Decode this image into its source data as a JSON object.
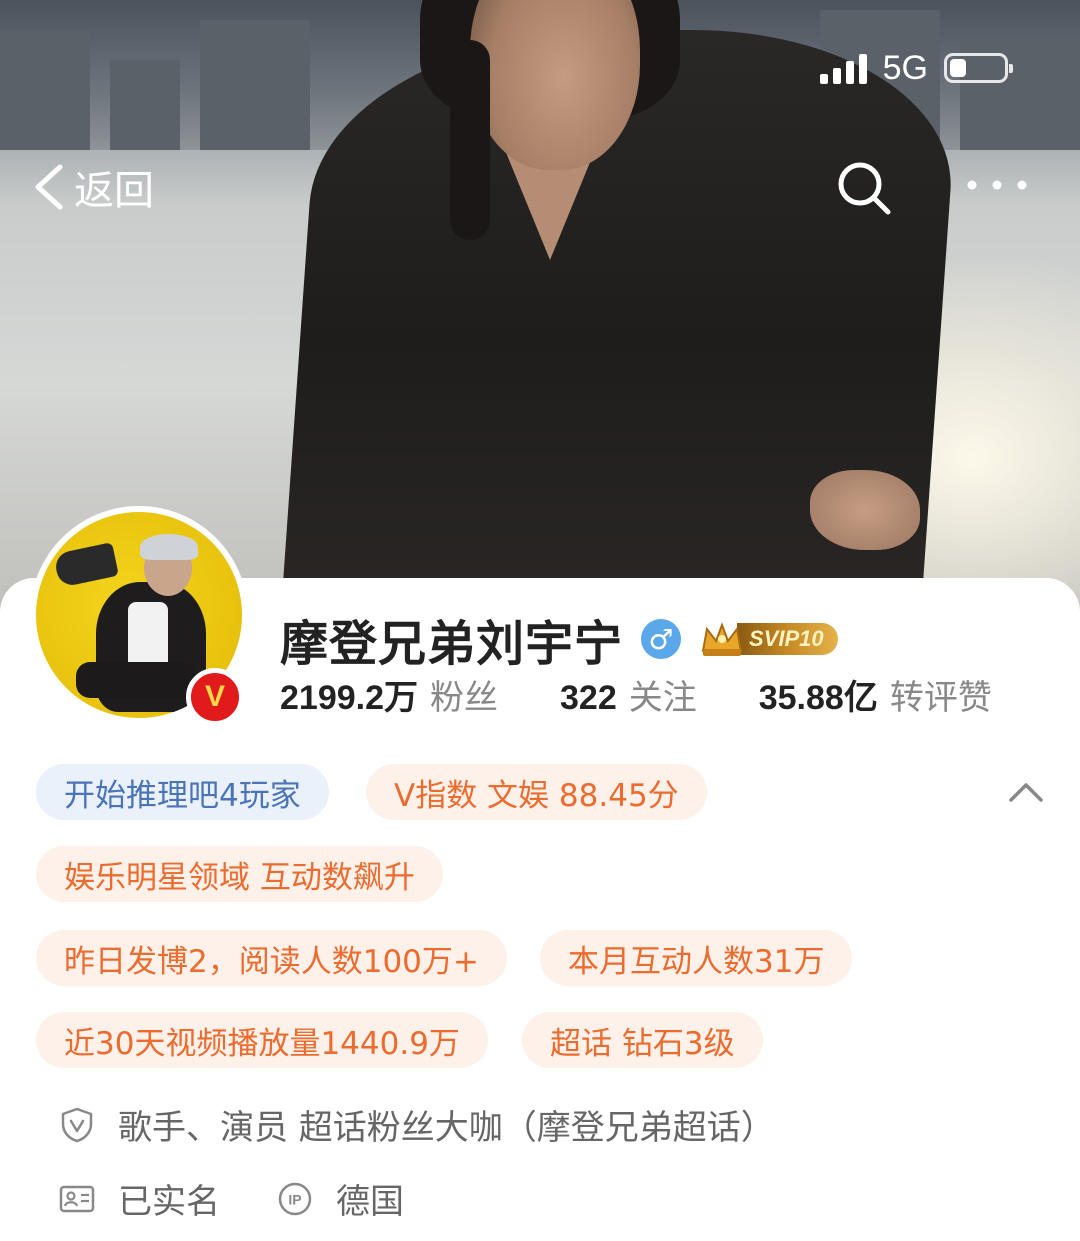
{
  "status_bar": {
    "network": "5G",
    "battery_level": 0.3
  },
  "nav": {
    "back_label": "返回"
  },
  "profile": {
    "name": "摩登兄弟刘宇宁",
    "vip_label": "SVIP10",
    "stats": [
      {
        "value": "2199.2万",
        "label": "粉丝"
      },
      {
        "value": "322",
        "label": "关注"
      },
      {
        "value": "35.88亿",
        "label": "转评赞"
      }
    ]
  },
  "tags": [
    "开始推理吧4玩家",
    "V指数 文娱 88.45分",
    "娱乐明星领域 互动数飙升",
    "昨日发博2，阅读人数100万+",
    "本月互动人数31万",
    "近30天视频播放量1440.9万",
    "超话 钻石3级"
  ],
  "info": {
    "verification": "歌手、演员 超话粉丝大咖（摩登兄弟超话）",
    "real_name": "已实名",
    "ip_location": "德国"
  },
  "colors": {
    "accent_blue": "#4a74b8",
    "accent_orange": "#ec6b2e",
    "verified_red": "#e11b1b",
    "gender_blue": "#5aa7ea"
  }
}
